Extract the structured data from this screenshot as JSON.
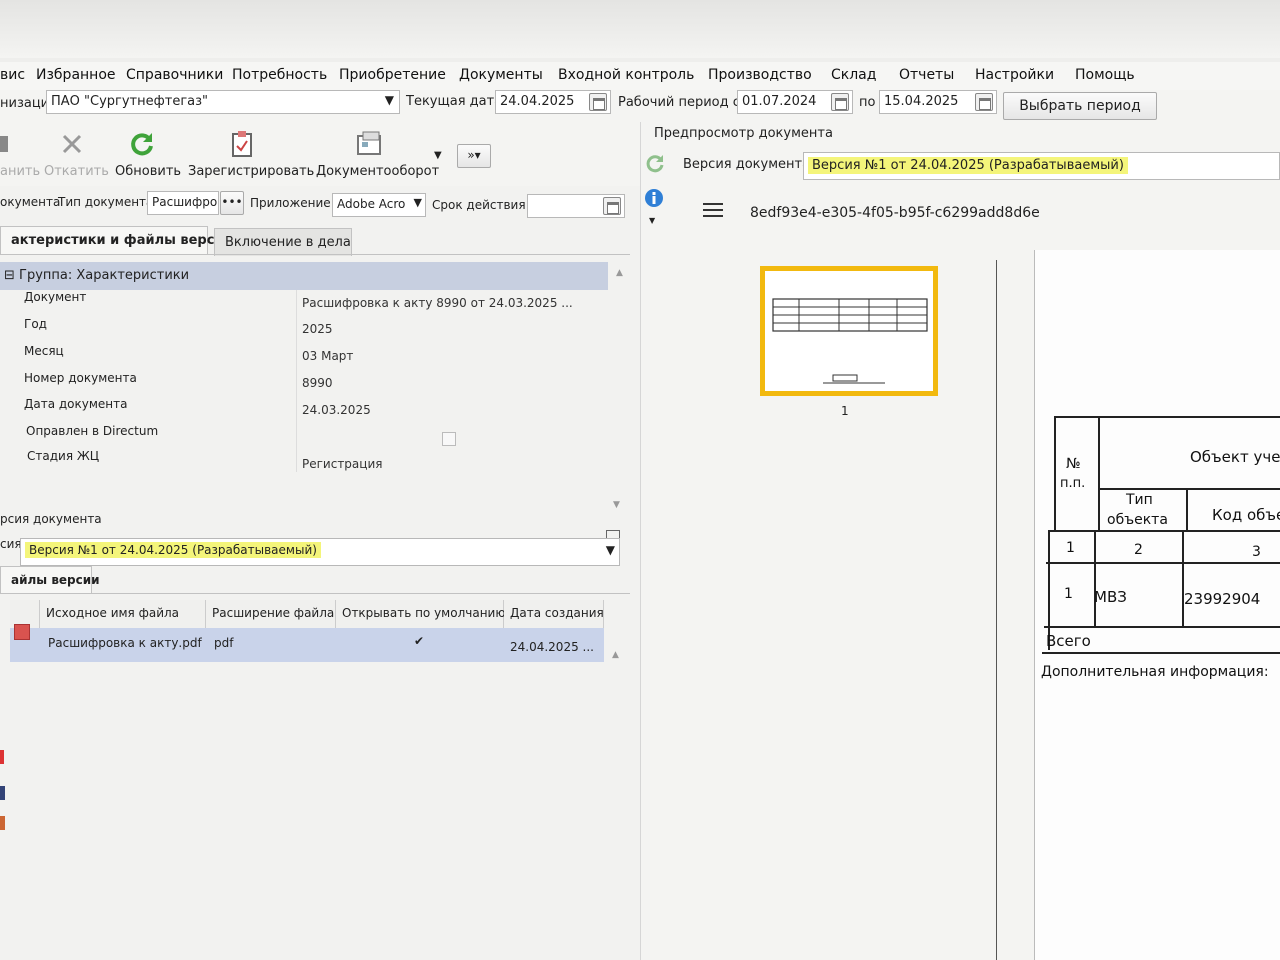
{
  "menu": [
    "вис",
    "Избранное",
    "Справочники",
    "Потребность",
    "Приобретение",
    "Документы",
    "Входной контроль",
    "Производство",
    "Склад",
    "Отчеты",
    "Настройки",
    "Помощь"
  ],
  "org_row": {
    "org_label": "низация",
    "org_value": "ПАО \"Сургутнефтегаз\"",
    "current_date_label": "Текущая дата",
    "current_date": "24.04.2025",
    "period_label": "Рабочий период с",
    "period_from": "01.07.2024",
    "period_to_label": "по",
    "period_to": "15.04.2025",
    "select_period_button": "Выбрать период"
  },
  "toolbar": {
    "save": "анить",
    "rollback": "Откатить",
    "refresh": "Обновить",
    "register": "Зарегистрировать",
    "docflow": "Документооборот"
  },
  "doc_row": {
    "doc_label": "окумента",
    "type_label": "Тип документа",
    "type_value": "Расшифров",
    "app_label": "Приложение",
    "app_value": "Adobe Acro",
    "validity_label": "Срок действия"
  },
  "tabs": {
    "tab1": "актеристики и файлы версии",
    "tab2": "Включение в дела"
  },
  "group": {
    "title": "Группа: Характеристики",
    "props": [
      {
        "name": "Документ",
        "value": "Расшифровка к акту 8990 от 24.03.2025 ..."
      },
      {
        "name": "Год",
        "value": "2025"
      },
      {
        "name": "Месяц",
        "value": "03 Март"
      },
      {
        "name": "Номер документа",
        "value": "8990"
      },
      {
        "name": "Дата документа",
        "value": "24.03.2025"
      },
      {
        "name": "Оправлен в Directum",
        "value": ""
      },
      {
        "name": "Стадия ЖЦ",
        "value": "Регистрация"
      }
    ]
  },
  "version": {
    "section_label": "рсия документа",
    "label": "сия",
    "value": "Версия №1 от 24.04.2025 (Разрабатываемый)"
  },
  "files": {
    "tab": "айлы версии",
    "headers": [
      "Исходное имя файла",
      "Расширение файла",
      "Открывать по умолчанию",
      "Дата создания"
    ],
    "rows": [
      {
        "name": "Расшифровка к акту.pdf",
        "ext": "pdf",
        "default": "✔",
        "created": "24.04.2025 ..."
      }
    ]
  },
  "preview": {
    "title": "Предпросмотр документа",
    "version_label": "Версия документа",
    "version_value": "Версия №1 от 24.04.2025 (Разрабатываемый)",
    "guid": "8edf93e4-e305-4f05-b95f-c6299add8d6e",
    "page_number": "1",
    "table": {
      "col_no": "№",
      "col_no2": "п.п.",
      "col_object": "Объект уче",
      "col_type": "Тип",
      "col_type2": "объекта",
      "col_code": "Код объе",
      "idx1": "1",
      "idx2": "2",
      "idx3": "3",
      "row_no": "1",
      "row_type": "МВЗ",
      "row_code": "23992904",
      "total": "Всего",
      "extra": "Дополнительная информация:"
    }
  },
  "colors": {
    "highlight": "#f4f57a",
    "selection": "#c9d3ea",
    "thumb_border": "#f2b90f"
  }
}
